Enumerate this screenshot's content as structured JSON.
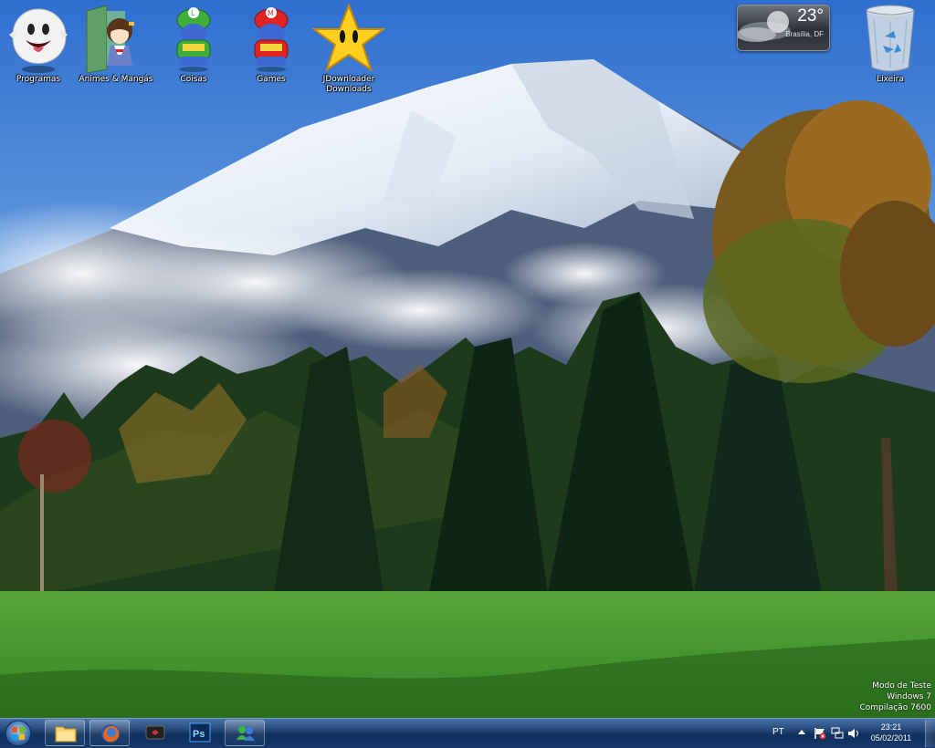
{
  "desktop": {
    "icons": [
      {
        "label": "Programas",
        "icon": "boo-ghost-icon"
      },
      {
        "label": "Animes & Mangás",
        "icon": "anime-folder-icon"
      },
      {
        "label": "Coisas",
        "icon": "luigi-icon"
      },
      {
        "label": "Games",
        "icon": "mario-icon"
      },
      {
        "label": "JDownloader\nDownloads",
        "icon": "star-icon"
      },
      {
        "label": "Lixeira",
        "icon": "recycle-bin-icon"
      }
    ]
  },
  "weather": {
    "temperature": "23°",
    "city": "Brasília, DF"
  },
  "watermark": {
    "line1": "Modo de Teste",
    "line2": "Windows 7",
    "line3": "Compilação 7600"
  },
  "taskbar": {
    "buttons": [
      {
        "icon": "windows-explorer-icon"
      },
      {
        "icon": "firefox-icon"
      },
      {
        "icon": "media-center-icon"
      },
      {
        "icon": "photoshop-icon",
        "text": "Ps"
      },
      {
        "icon": "messenger-icon"
      }
    ],
    "language": "PT",
    "clock": {
      "time": "23:21",
      "date": "05/02/2011"
    }
  },
  "colors": {
    "sky": "#3f7fd1",
    "grass": "#3e8b2a",
    "taskbar": "#1c3f6e"
  }
}
